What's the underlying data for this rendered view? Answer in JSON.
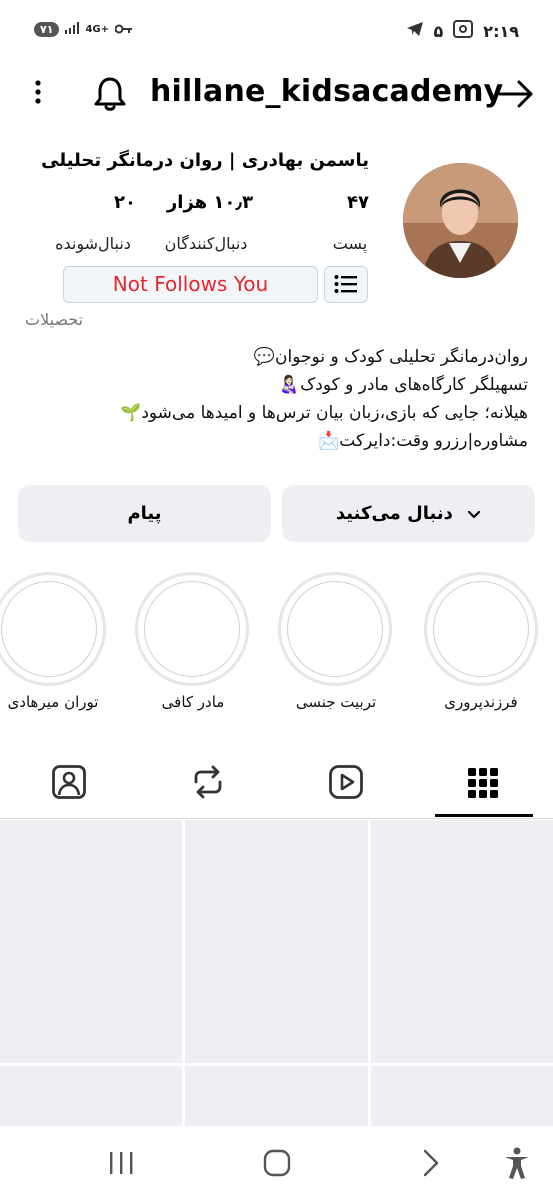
{
  "status_bar": {
    "battery": "۷۱",
    "network": "4G+",
    "time": "۲:۱۹",
    "notification_count": "۵"
  },
  "header": {
    "username": "hillane_kidsacademy"
  },
  "profile": {
    "name": "یاسمن بهادری | روان درمانگر تحلیلی",
    "stats": [
      {
        "value": "۴۷",
        "label": "پست"
      },
      {
        "value": "۱۰٫۳ هزار",
        "label": "دنبال‌کنندگان"
      },
      {
        "value": "۲۰",
        "label": "دنبال‌شونده"
      }
    ],
    "not_follows_label": "Not Follows You",
    "education_link": "تحصیلات",
    "bio_lines": [
      "روان‌درمانگر تحلیلی کودک و نوجوان💬",
      "تسهیلگر کارگاه‌های مادر و کودک👩🏻‍🍼",
      "هیلانه؛ جایی که بازی،زبان بیان ترس‌ها و امیدها می‌شود🌱",
      "مشاوره|رزرو وقت:دایرکت📩"
    ]
  },
  "actions": {
    "following_label": "دنبال می‌کنید",
    "message_label": "پیام"
  },
  "highlights": [
    {
      "label": "فرزندپروری"
    },
    {
      "label": "تربیت جنسی"
    },
    {
      "label": "مادر کافی"
    },
    {
      "label": "توران میرهادی"
    }
  ],
  "tabs": [
    {
      "icon": "grid-icon"
    },
    {
      "icon": "reels-icon"
    },
    {
      "icon": "repost-icon"
    },
    {
      "icon": "tagged-icon"
    }
  ],
  "colors": {
    "not_follows_text": "#e2282e",
    "button_bg": "#efeff3"
  }
}
